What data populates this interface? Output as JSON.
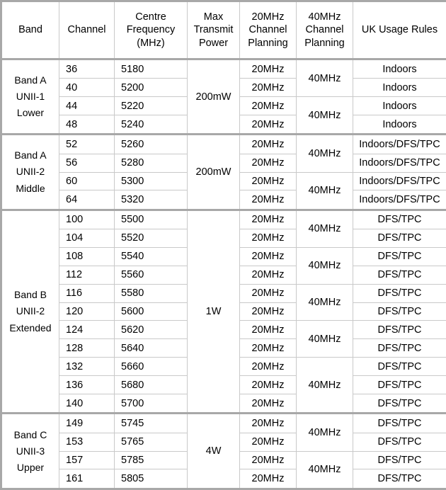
{
  "table": {
    "headers": [
      {
        "name": "band",
        "lines": [
          "Band"
        ]
      },
      {
        "name": "channel",
        "lines": [
          "Channel"
        ]
      },
      {
        "name": "centre-frequency",
        "lines": [
          "Centre",
          "Frequency",
          "(MHz)"
        ]
      },
      {
        "name": "max-transmit-power",
        "lines": [
          "Max",
          "Transmit",
          "Power"
        ]
      },
      {
        "name": "20mhz-channel-planning",
        "lines": [
          "20MHz",
          "Channel",
          "Planning"
        ]
      },
      {
        "name": "40mhz-channel-planning",
        "lines": [
          "40MHz",
          "Channel",
          "Planning"
        ]
      },
      {
        "name": "uk-usage-rules",
        "lines": [
          "UK Usage Rules"
        ]
      }
    ],
    "bands": [
      {
        "band_lines": [
          "Band A",
          "UNII-1",
          "Lower"
        ],
        "power": "200mW",
        "rows": [
          {
            "channel": "36",
            "frequency": "5180",
            "planning20": "20MHz",
            "planning40": "40MHz",
            "rules": "Indoors"
          },
          {
            "channel": "40",
            "frequency": "5200",
            "planning20": "20MHz",
            "planning40": "",
            "rules": "Indoors"
          },
          {
            "channel": "44",
            "frequency": "5220",
            "planning20": "20MHz",
            "planning40": "40MHz",
            "rules": "Indoors"
          },
          {
            "channel": "48",
            "frequency": "5240",
            "planning20": "20MHz",
            "planning40": "",
            "rules": "Indoors"
          }
        ]
      },
      {
        "band_lines": [
          "Band A",
          "UNII-2",
          "Middle"
        ],
        "power": "200mW",
        "rows": [
          {
            "channel": "52",
            "frequency": "5260",
            "planning20": "20MHz",
            "planning40": "40MHz",
            "rules": "Indoors/DFS/TPC"
          },
          {
            "channel": "56",
            "frequency": "5280",
            "planning20": "20MHz",
            "planning40": "",
            "rules": "Indoors/DFS/TPC"
          },
          {
            "channel": "60",
            "frequency": "5300",
            "planning20": "20MHz",
            "planning40": "40MHz",
            "rules": "Indoors/DFS/TPC"
          },
          {
            "channel": "64",
            "frequency": "5320",
            "planning20": "20MHz",
            "planning40": "",
            "rules": "Indoors/DFS/TPC"
          }
        ]
      },
      {
        "band_lines": [
          "Band B",
          "UNII-2",
          "Extended"
        ],
        "power": "1W",
        "rows": [
          {
            "channel": "100",
            "frequency": "5500",
            "planning20": "20MHz",
            "planning40": "40MHz",
            "rules": "DFS/TPC"
          },
          {
            "channel": "104",
            "frequency": "5520",
            "planning20": "20MHz",
            "planning40": "",
            "rules": "DFS/TPC"
          },
          {
            "channel": "108",
            "frequency": "5540",
            "planning20": "20MHz",
            "planning40": "40MHz",
            "rules": "DFS/TPC"
          },
          {
            "channel": "112",
            "frequency": "5560",
            "planning20": "20MHz",
            "planning40": "",
            "rules": "DFS/TPC"
          },
          {
            "channel": "116",
            "frequency": "5580",
            "planning20": "20MHz",
            "planning40": "40MHz",
            "rules": "DFS/TPC"
          },
          {
            "channel": "120",
            "frequency": "5600",
            "planning20": "20MHz",
            "planning40": "",
            "rules": "DFS/TPC"
          },
          {
            "channel": "124",
            "frequency": "5620",
            "planning20": "20MHz",
            "planning40": "40MHz",
            "rules": "DFS/TPC"
          },
          {
            "channel": "128",
            "frequency": "5640",
            "planning20": "20MHz",
            "planning40": "",
            "rules": "DFS/TPC"
          },
          {
            "channel": "132",
            "frequency": "5660",
            "planning20": "20MHz",
            "planning40": "40MHz",
            "rules": "DFS/TPC"
          },
          {
            "channel": "136",
            "frequency": "5680",
            "planning20": "20MHz",
            "planning40": "",
            "rules": "DFS/TPC"
          },
          {
            "channel": "140",
            "frequency": "5700",
            "planning20": "20MHz",
            "planning40": "",
            "rules": "DFS/TPC"
          }
        ]
      },
      {
        "band_lines": [
          "Band C",
          "UNII-3",
          "Upper"
        ],
        "power": "4W",
        "rows": [
          {
            "channel": "149",
            "frequency": "5745",
            "planning20": "20MHz",
            "planning40": "40MHz",
            "rules": "DFS/TPC"
          },
          {
            "channel": "153",
            "frequency": "5765",
            "planning20": "20MHz",
            "planning40": "",
            "rules": "DFS/TPC"
          },
          {
            "channel": "157",
            "frequency": "5785",
            "planning20": "20MHz",
            "planning40": "40MHz",
            "rules": "DFS/TPC"
          },
          {
            "channel": "161",
            "frequency": "5805",
            "planning20": "20MHz",
            "planning40": "",
            "rules": "DFS/TPC"
          }
        ]
      }
    ]
  },
  "colors": {
    "outer_border": "#a8a8a8",
    "inner_border": "#c9c9c9",
    "background": "#ffffff",
    "text": "#000000"
  }
}
